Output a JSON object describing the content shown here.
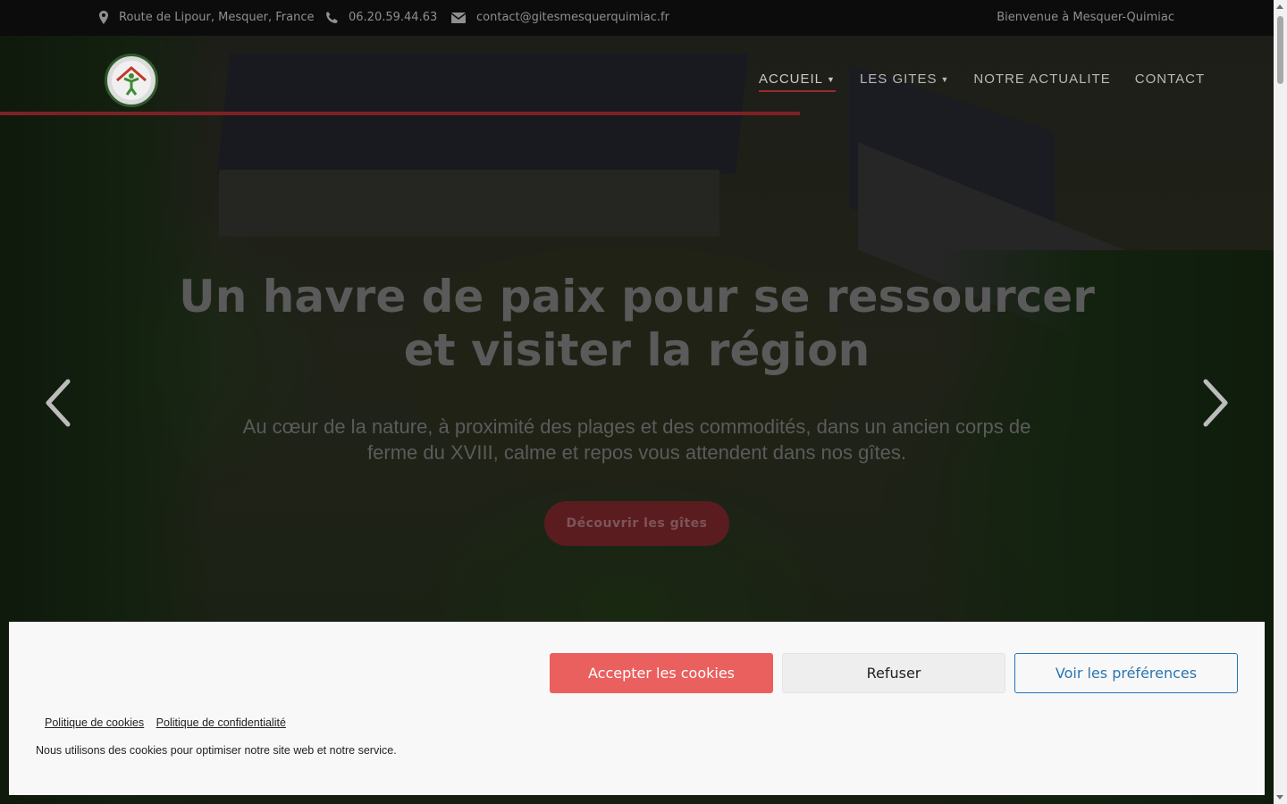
{
  "topbar": {
    "address": "Route de Lipour, Mesquer, France",
    "phone": "06.20.59.44.63",
    "email": "contact@gitesmesquerquimiac.fr",
    "welcome": "Bienvenue à Mesquer-Quimiac"
  },
  "nav": {
    "items": [
      {
        "label": "ACCUEIL",
        "has_dropdown": true,
        "active": true
      },
      {
        "label": "LES GITES",
        "has_dropdown": true,
        "active": false
      },
      {
        "label": "NOTRE ACTUALITE",
        "has_dropdown": false,
        "active": false
      },
      {
        "label": "CONTACT",
        "has_dropdown": false,
        "active": false
      }
    ]
  },
  "hero": {
    "title_line1": "Un havre de paix pour se ressourcer",
    "title_line2": "et visiter la région",
    "subtitle_line1": "Au cœur de la nature, à proximité des plages et des commodités, dans un ancien corps de",
    "subtitle_line2": "ferme du XVIII, calme et repos vous attendent dans nos gîtes.",
    "cta_label": "Découvrir les gîtes"
  },
  "cookie_banner": {
    "accept_label": "Accepter les cookies",
    "refuse_label": "Refuser",
    "preferences_label": "Voir les préférences",
    "cookie_policy_link": "Politique de cookies",
    "privacy_policy_link": "Politique de confidentialité",
    "message": "Nous utilisons des cookies pour optimiser notre site web et notre service."
  },
  "colors": {
    "accent_red": "#e9605e",
    "brand_dark_red": "#7e2125",
    "prefs_blue": "#2a74b0"
  },
  "icons": [
    "map-marker-icon",
    "phone-icon",
    "envelope-icon",
    "chevron-left-icon",
    "chevron-right-icon",
    "gites-de-france-logo"
  ]
}
